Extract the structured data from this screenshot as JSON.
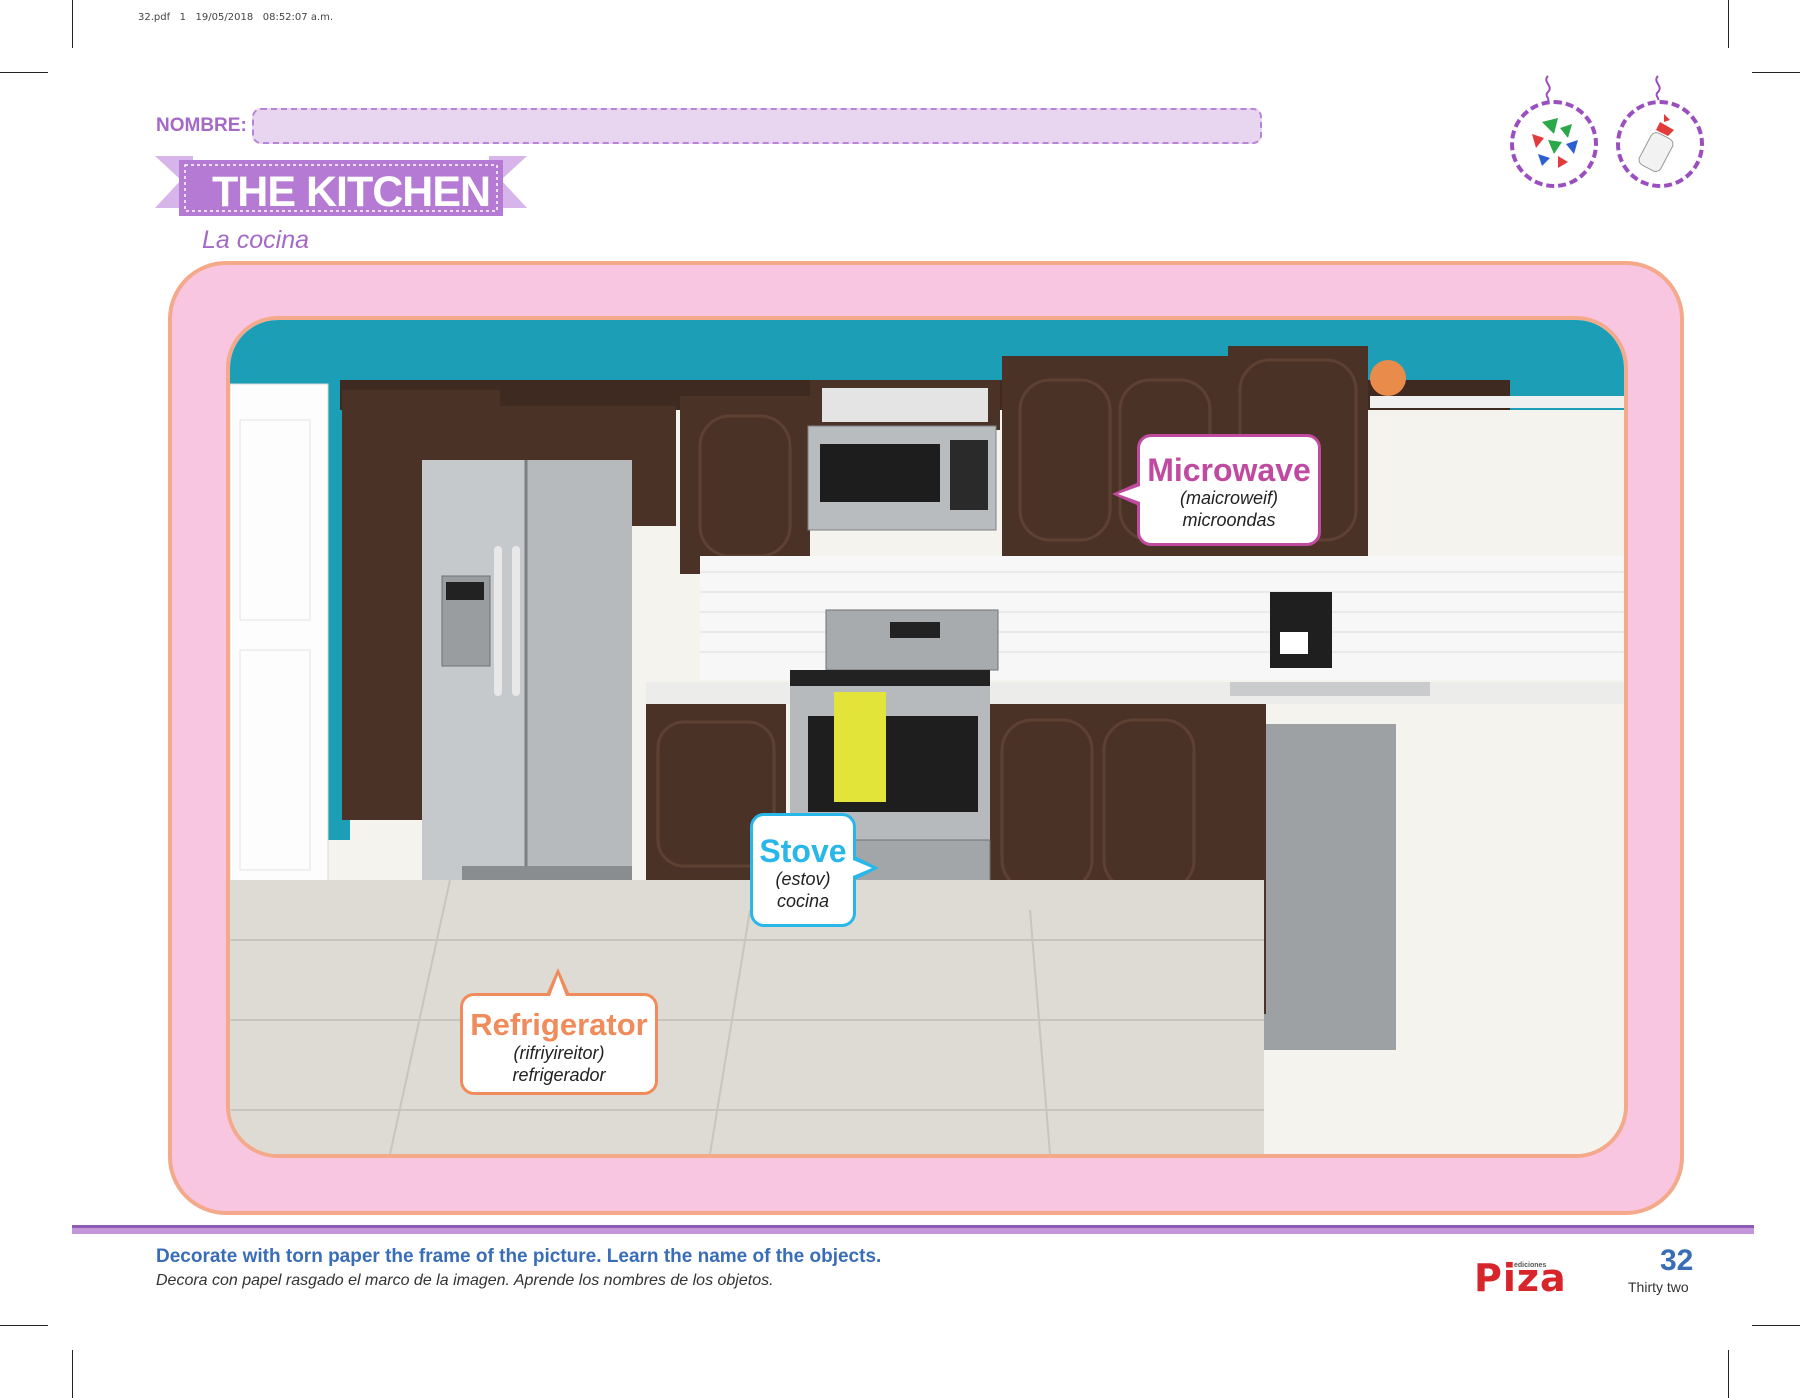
{
  "print_meta": "32.pdf   1   19/05/2018   08:52:07 a.m.",
  "header": {
    "name_label": "NOMBRE:",
    "title": "THE KITCHEN",
    "subtitle": "La cocina"
  },
  "callouts": {
    "microwave": {
      "word": "Microwave",
      "pronunciation": "(maicroweif)",
      "spanish": "microondas"
    },
    "stove": {
      "word": "Stove",
      "pronunciation": "(estov)",
      "spanish": "cocina"
    },
    "refrigerator": {
      "word": "Refrigerator",
      "pronunciation": "(rifriyireitor)",
      "spanish": "refrigerador"
    }
  },
  "footer": {
    "instruction_en": "Decorate with torn paper the frame of the picture. Learn the name of the objects.",
    "instruction_es": "Decora con papel rasgado el marco de la imagen. Aprende los nombres de los objetos.",
    "publisher_small": "ediciones",
    "publisher": "Piza",
    "page_number": "32",
    "page_word": "Thirty two"
  },
  "colors": {
    "purple": "#a569c7",
    "frame_pink": "#f8c6e1",
    "frame_border": "#f5a98b",
    "microwave_accent": "#c14aa1",
    "stove_accent": "#29b6e8",
    "fridge_accent": "#f08b5c",
    "footer_blue": "#3a6db8"
  },
  "icons": [
    "torn-paper-icon",
    "glue-bottle-icon"
  ]
}
